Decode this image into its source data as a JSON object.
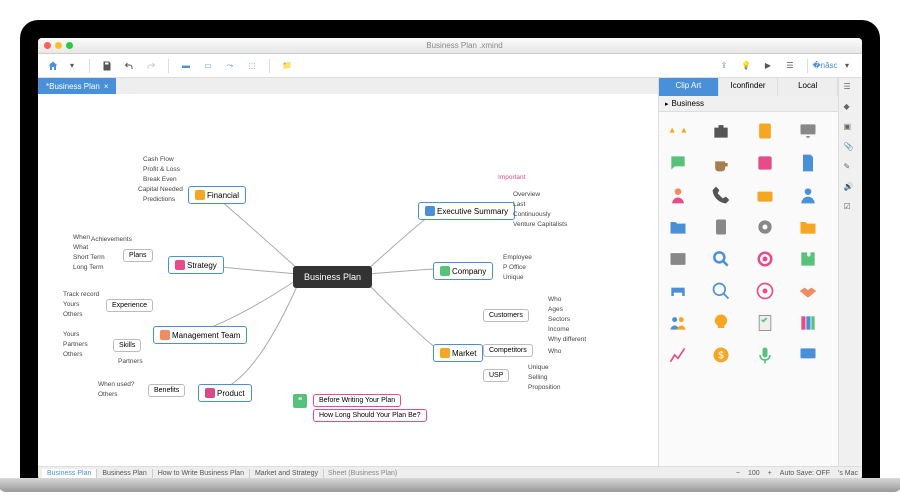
{
  "window": {
    "title": "Business Plan .xmind"
  },
  "document_tab": {
    "label": "*Business Plan",
    "close": "×"
  },
  "toolbar": {
    "home": "home",
    "save": "save",
    "undo": "undo",
    "redo": "redo",
    "topic": "topic",
    "subtopic": "subtopic",
    "relationship": "relationship",
    "boundary": "boundary",
    "folder": "folder",
    "export": "export",
    "idea": "idea",
    "presentation": "presentation",
    "gantt": "gantt",
    "share": "share"
  },
  "mindmap": {
    "center": "Business Plan",
    "branches": [
      {
        "id": "financial",
        "label": "Financial",
        "color": "#f5a623",
        "children": [
          "Cash Flow",
          "Profit & Loss",
          "Break Even",
          "Capital Needed",
          "Predictions"
        ]
      },
      {
        "id": "strategy",
        "label": "Strategy",
        "color": "#e84c88",
        "sub": {
          "label": "Plans",
          "children": [
            "What",
            "Achievements",
            "Short Term",
            "Long Term"
          ]
        },
        "extra": "When"
      },
      {
        "id": "mgmt",
        "label": "Management Team",
        "color": "#f08b62",
        "sub": {
          "label": "Experience",
          "children": [
            "Track record",
            "Yours",
            "Others"
          ]
        },
        "sub2": {
          "label": "Skills",
          "children": [
            "Yours",
            "Partners",
            "Others"
          ]
        },
        "extra": "Partners"
      },
      {
        "id": "product",
        "label": "Product",
        "color": "#d94b87",
        "sub": {
          "label": "Benefits",
          "children": [
            "When used?",
            "Others"
          ]
        }
      },
      {
        "id": "exec",
        "label": "Executive Summary",
        "color": "#4a90d9",
        "children": [
          "Overview",
          "Last",
          "Continuously",
          "Venture Capitalists"
        ],
        "callout": "Important"
      },
      {
        "id": "company",
        "label": "Company",
        "color": "#58c27d",
        "children": [
          "Employee",
          "P Office",
          "Unique"
        ]
      },
      {
        "id": "market",
        "label": "Market",
        "color": "#f5a623",
        "subs": [
          {
            "label": "Customers",
            "children": [
              "Who",
              "Ages",
              "Sectors",
              "Income",
              "Why different"
            ]
          },
          {
            "label": "Competitors",
            "children": [
              "Who"
            ]
          },
          {
            "label": "USP",
            "children": [
              "Unique",
              "Selling",
              "Proposition"
            ]
          }
        ],
        "notes": [
          "Before Writing Your Plan",
          "How Long Should Your Plan Be?"
        ]
      }
    ]
  },
  "sidepanel": {
    "tabs": [
      "Clip Art",
      "Iconfinder",
      "Local"
    ],
    "active_tab": 0,
    "category": "Business",
    "icons": [
      "scales",
      "briefcase",
      "calculator",
      "desktop",
      "chat",
      "coffee",
      "abacus",
      "document",
      "support-agent",
      "phone",
      "radio",
      "user",
      "folder-blue",
      "clipboard",
      "gear",
      "folder-orange",
      "window",
      "magnifier",
      "target",
      "puzzle",
      "printer",
      "search",
      "bullseye",
      "handshake",
      "people",
      "lightbulb",
      "checklist",
      "books",
      "chart",
      "coin",
      "microphone",
      "monitor",
      "panel",
      "sheet"
    ]
  },
  "vtoolbar": [
    "outline",
    "marker",
    "image",
    "attachment",
    "note",
    "audio",
    "task"
  ],
  "statusbar": {
    "sheets": [
      "Business Plan",
      "Business Plan",
      "How to Write Business Plan",
      "Market and Strategy"
    ],
    "sheet_label": "Sheet (Business Plan)",
    "zoom_out": "−",
    "zoom_level": "100",
    "zoom_in": "+",
    "autosave": "Auto Save: OFF",
    "user": "'s Mac"
  }
}
